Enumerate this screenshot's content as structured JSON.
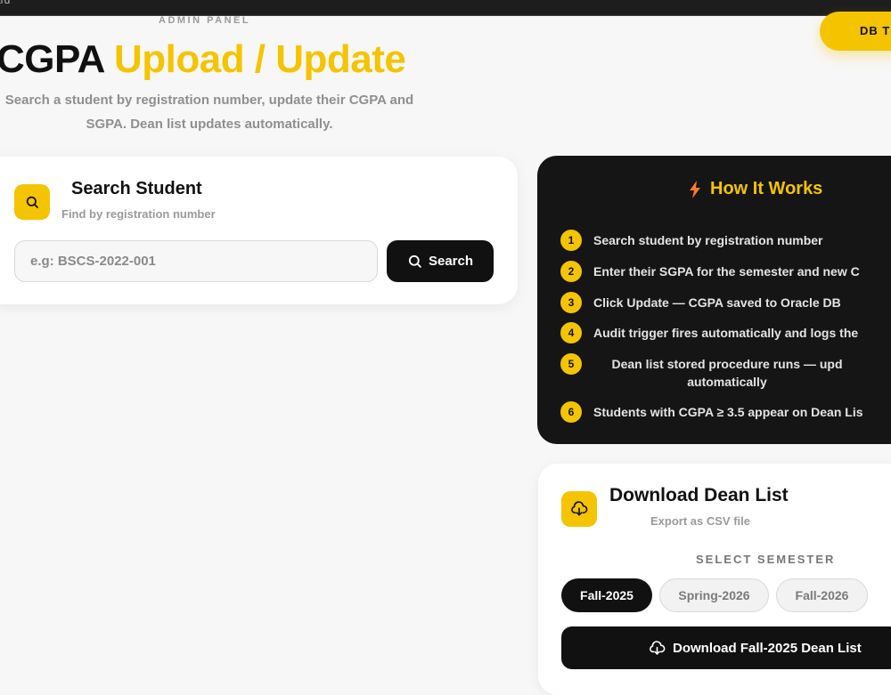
{
  "browser": {
    "tab_fragment": "ard"
  },
  "header": {
    "eyebrow": "ADMIN PANEL",
    "db_pill": "DB T",
    "title_black": "CGPA",
    "title_yellow": "Upload / Update",
    "subtitle": "Search a student by registration number, update their CGPA and SGPA. Dean list updates automatically."
  },
  "search": {
    "title": "Search Student",
    "subtitle": "Find by registration number",
    "placeholder": "e.g: BSCS-2022-001",
    "button_label": "Search"
  },
  "how_it_works": {
    "title": "How It Works",
    "steps": [
      {
        "num": "1",
        "text": "Search student by registration number"
      },
      {
        "num": "2",
        "text": "Enter their SGPA for the semester and new C"
      },
      {
        "num": "3",
        "text": "Click Update — CGPA saved to Oracle DB"
      },
      {
        "num": "4",
        "text": "Audit trigger fires automatically and logs the"
      },
      {
        "num": "5",
        "text": "Dean list stored procedure runs — upd automatically"
      },
      {
        "num": "6",
        "text": "Students with CGPA ≥ 3.5 appear on Dean Lis"
      }
    ]
  },
  "download": {
    "title": "Download Dean List",
    "subtitle": "Export as CSV file",
    "semester_label": "SELECT SEMESTER",
    "semesters": [
      "Fall-2025",
      "Spring-2026",
      "Fall-2026"
    ],
    "selected": "Fall-2025",
    "button_label": "Download Fall-2025 Dean List"
  },
  "colors": {
    "accent": "#f5c400",
    "dark": "#151515",
    "background": "#f7f7f7"
  }
}
